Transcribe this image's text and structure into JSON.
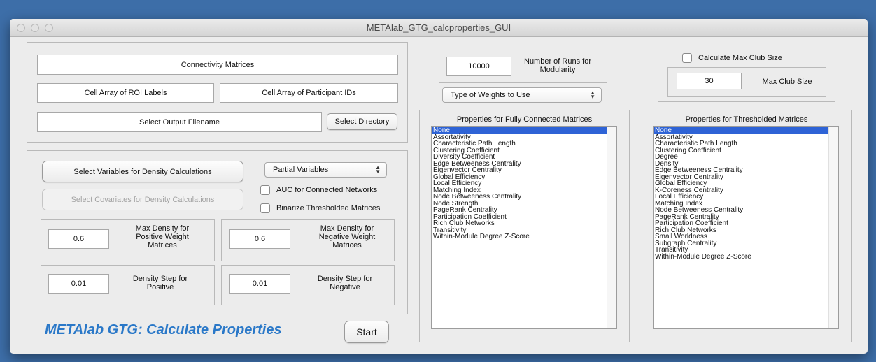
{
  "window": {
    "title": "METAlab_GTG_calcproperties_GUI"
  },
  "inputs": {
    "connectivity_matrices": "Connectivity Matrices",
    "roi_labels": "Cell Array of ROI Labels",
    "participant_ids": "Cell Array of Participant IDs",
    "output_filename": "Select Output Filename",
    "select_directory": "Select Directory"
  },
  "density": {
    "select_variables": "Select Variables for Density Calculations",
    "select_covariates": "Select Covariates for Density Calculations",
    "partial_variables": "Partial Variables",
    "auc_label": "AUC for Connected Networks",
    "binarize_label": "Binarize Thresholded Matrices",
    "max_pos_value": "0.6",
    "max_pos_label": "Max Density for Positive Weight Matrices",
    "max_neg_value": "0.6",
    "max_neg_label": "Max Density for Negative Weight Matrices",
    "step_pos_value": "0.01",
    "step_pos_label": "Density Step for Positive",
    "step_neg_value": "0.01",
    "step_neg_label": "Density Step for Negative"
  },
  "brand": "METAlab GTG: Calculate Properties",
  "start_label": "Start",
  "modularity": {
    "runs_value": "10000",
    "runs_label": "Number of Runs for Modularity"
  },
  "weights_select": "Type of Weights to Use",
  "club": {
    "checkbox_label": "Calculate Max Club Size",
    "value": "30",
    "label": "Max Club Size"
  },
  "fully_connected": {
    "title": "Properties for Fully Connected Matrices",
    "items": [
      "None",
      "Assortativity",
      "Characteristic Path Length",
      "Clustering Coefficient",
      "Diversity Coefficient",
      "Edge Betweeness Centrality",
      "Eigenvector Centrality",
      "Global Efficiency",
      "Local Efficiency",
      "Matching Index",
      "Node Betweeness Centrality",
      "Node Strength",
      "PageRank Centrality",
      "Participation Coefficient",
      "Rich Club Networks",
      "Transitivity",
      "Within-Module Degree Z-Score"
    ]
  },
  "thresholded": {
    "title": "Properties for Thresholded Matrices",
    "items": [
      "None",
      "Assortativity",
      "Characteristic Path Length",
      "Clustering Coefficient",
      "Degree",
      "Density",
      "Edge Betweeness Centrality",
      "Eigenvector Centrality",
      "Global Efficiency",
      "K-Coreness Centrality",
      "Local Efficiency",
      "Matching Index",
      "Node Betweeness Centrality",
      "PageRank Centrality",
      "Participation Coefficient",
      "Rich Club Networks",
      "Small Worldness",
      "Subgraph Centrality",
      "Transitivity",
      "Within-Module Degree Z-Score"
    ]
  },
  "colors": {
    "selection": "#2e63d6",
    "brand": "#2a78c8"
  }
}
